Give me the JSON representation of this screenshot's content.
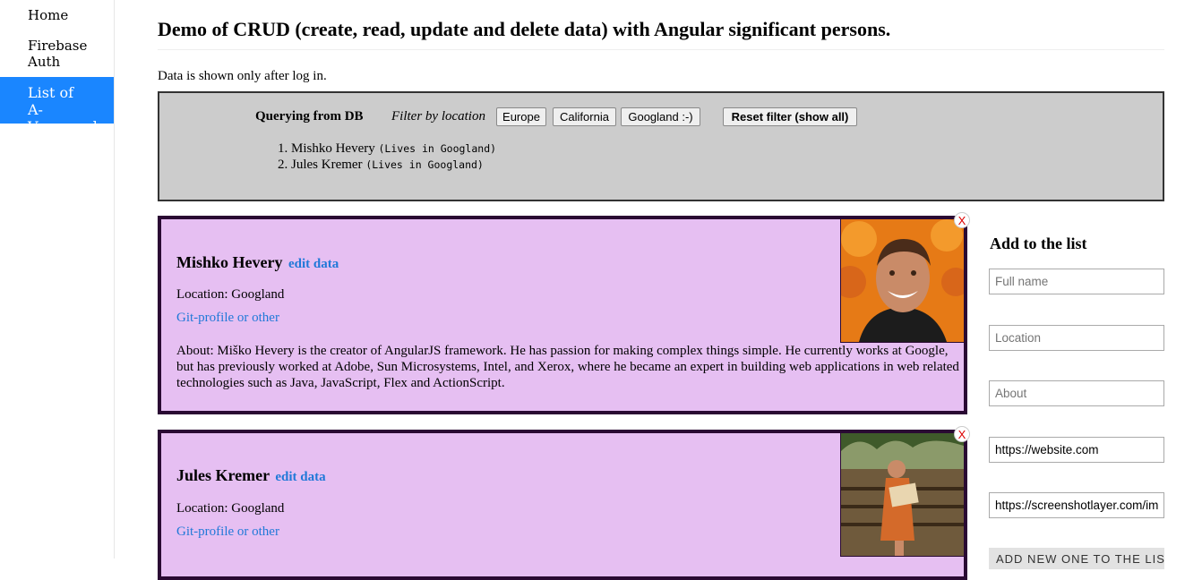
{
  "sidebar": {
    "items": [
      {
        "label": "Home"
      },
      {
        "label": "Firebase Auth"
      },
      {
        "label": "List of A-Vanguard",
        "active": true
      }
    ],
    "accent_color": "#1a86ff"
  },
  "header": {
    "title": "Demo of CRUD (create, read, update and delete data) with Angular significant persons.",
    "notice": "Data is shown only after log in."
  },
  "query": {
    "label": "Querying from DB",
    "filter_label": "Filter by location",
    "filters": [
      "Europe",
      "California",
      "Googland :-)"
    ],
    "reset_label": "Reset filter (show all)",
    "results": [
      {
        "name": "Mishko Hevery",
        "note": "(Lives in Googland)"
      },
      {
        "name": "Jules Kremer",
        "note": "(Lives in Googland)"
      }
    ]
  },
  "persons": [
    {
      "name": "Mishko Hevery",
      "edit_label": "edit data",
      "location": "Location: Googland",
      "link_label": "Git-profile or other",
      "about": "About: Miško Hevery is the creator of AngularJS framework. He has passion for making complex things simple. He currently works at Google, but has previously worked at Adobe, Sun Microsystems, Intel, and Xerox, where he became an expert in building web applications in web related technologies such as Java, JavaScript, Flex and ActionScript.",
      "photo_icon": "person-photo",
      "close_label": "X"
    },
    {
      "name": "Jules Kremer",
      "edit_label": "edit data",
      "location": "Location: Googland",
      "link_label": "Git-profile or other",
      "photo_icon": "person-photo",
      "close_label": "X"
    }
  ],
  "add_form": {
    "title": "Add to the list",
    "name_placeholder": "Full name",
    "location_placeholder": "Location",
    "about_placeholder": "About",
    "website_value": "https://website.com",
    "image_value": "https://screenshotlayer.com/images/",
    "submit_label": "ADD NEW ONE TO THE LIST"
  },
  "colors": {
    "card_bg": "#e6bff2",
    "card_border": "#2a0a33",
    "link": "#2179d8",
    "query_bg": "#cccccc"
  }
}
